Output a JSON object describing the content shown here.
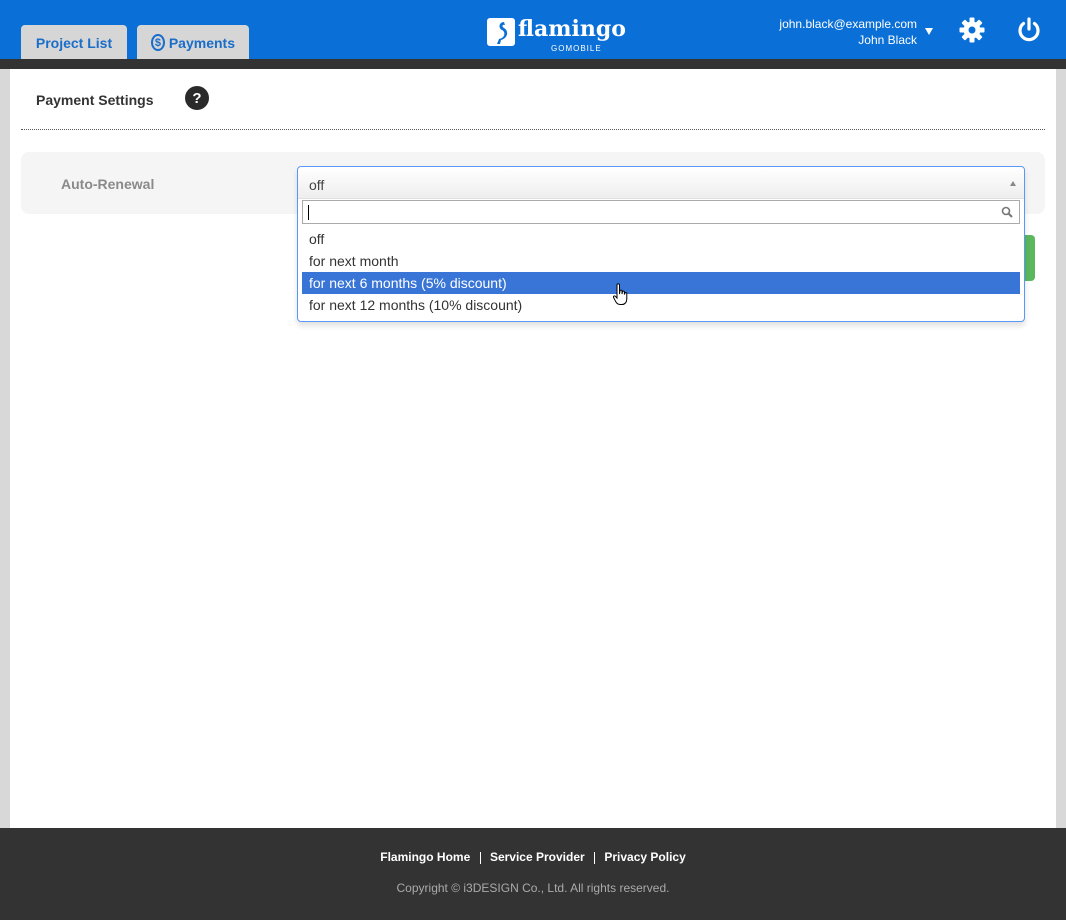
{
  "header": {
    "tabs": [
      {
        "label": "Project List"
      },
      {
        "label": "Payments",
        "icon": "dollar-circle-icon"
      }
    ],
    "logo": {
      "name": "flamingo",
      "sub": "GOMOBILE"
    },
    "user": {
      "email": "john.black@example.com",
      "name": "John Black"
    },
    "accent_color": "#0a6fd6"
  },
  "page": {
    "title": "Payment Settings",
    "help_label": "?"
  },
  "setting": {
    "label": "Auto-Renewal",
    "selected": "off",
    "search_value": "",
    "options": [
      "off",
      "for next month",
      "for next 6 months (5% discount)",
      "for next 12 months (10% discount)"
    ],
    "highlighted_index": 2
  },
  "footer": {
    "links": [
      "Flamingo Home",
      "Service Provider",
      "Privacy Policy"
    ],
    "copyright": "Copyright © i3DESIGN Co., Ltd. All rights reserved."
  }
}
